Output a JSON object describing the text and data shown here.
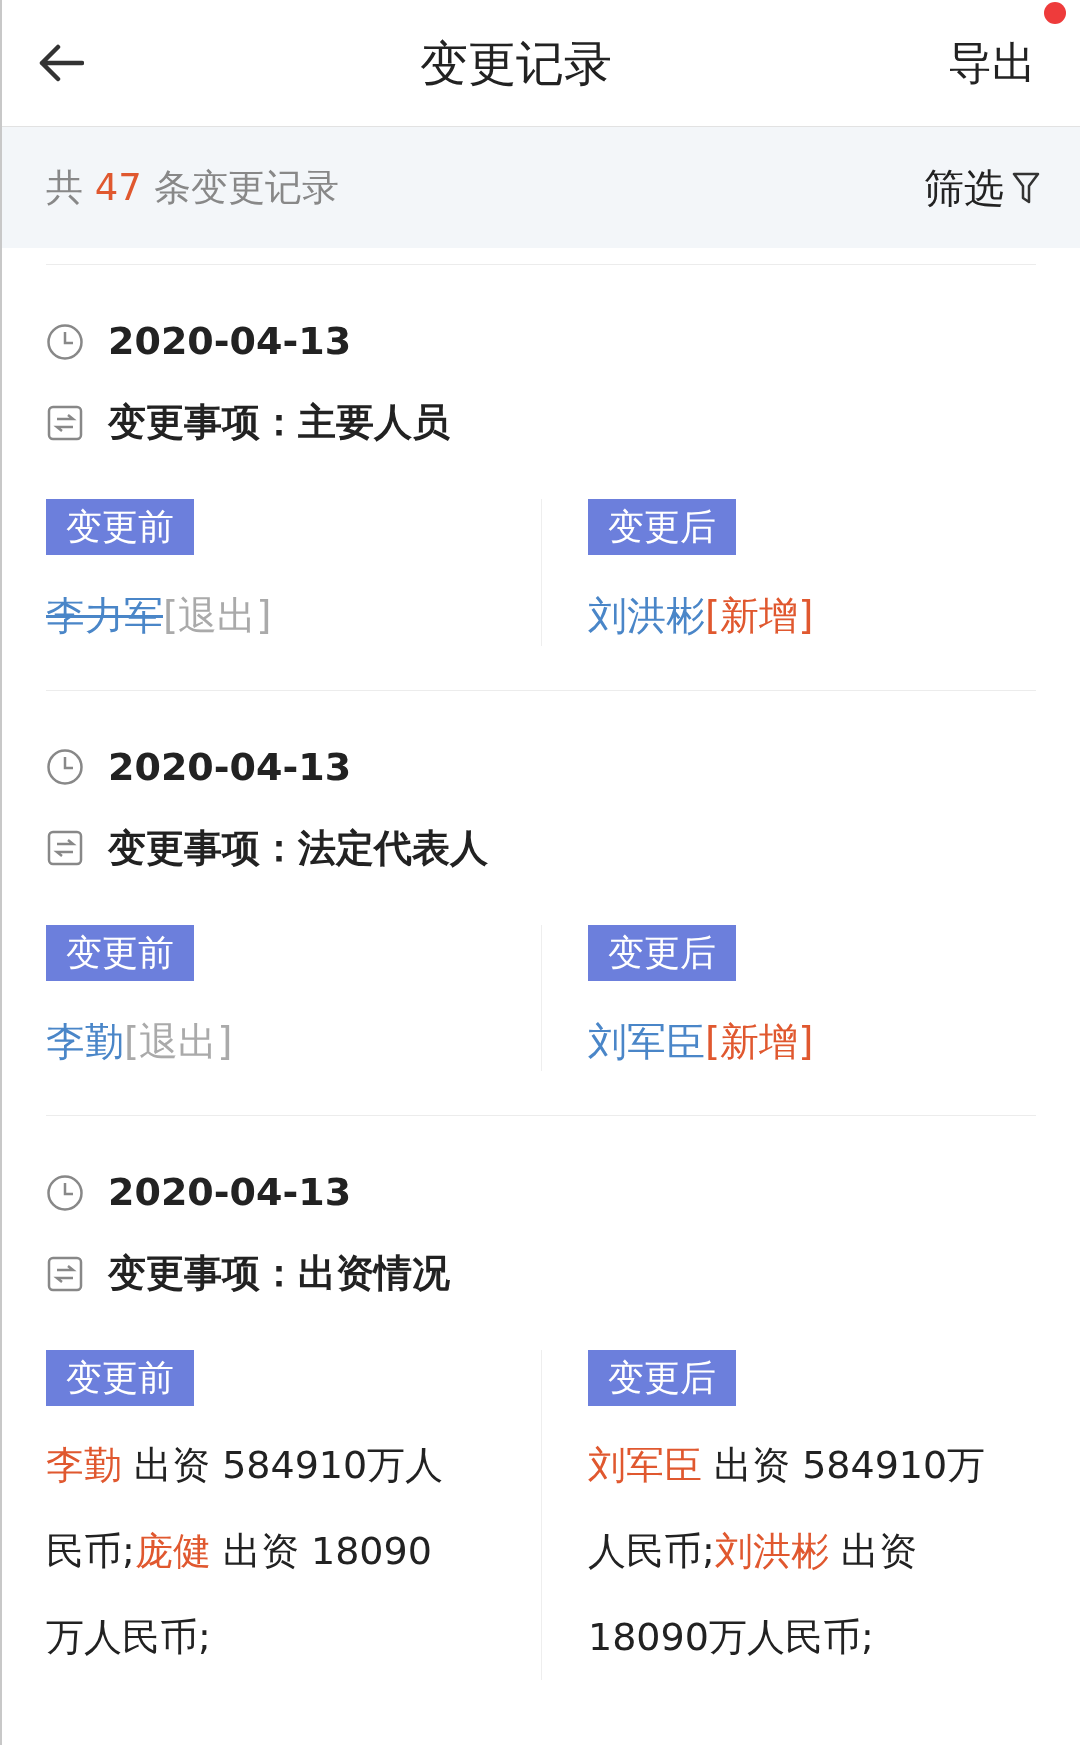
{
  "header": {
    "title": "变更记录",
    "action": {
      "label": "导出",
      "notification": true
    }
  },
  "summary": {
    "prefix": "共",
    "count": "47",
    "suffix": "条变更记录",
    "filter": "筛选"
  },
  "records": [
    {
      "date": "2020-04-13",
      "item": "变更事项：主要人员",
      "before_label": "变更前",
      "after_label": "变更后",
      "before": {
        "kind": "person",
        "name": "李力军",
        "tag": "[退出]",
        "added": false,
        "struck": true
      },
      "after": {
        "kind": "person",
        "name": "刘洪彬",
        "tag": "[新增]",
        "added": true,
        "struck": false
      }
    },
    {
      "date": "2020-04-13",
      "item": "变更事项：法定代表人",
      "before_label": "变更前",
      "after_label": "变更后",
      "before": {
        "kind": "person",
        "name": "李勤",
        "tag": "[退出]",
        "added": false,
        "struck": false
      },
      "after": {
        "kind": "person",
        "name": "刘军臣",
        "tag": "[新增]",
        "added": true,
        "struck": false
      }
    },
    {
      "date": "2020-04-13",
      "item": "变更事项：出资情况",
      "before_label": "变更前",
      "after_label": "变更后",
      "before": {
        "kind": "text",
        "parts": [
          {
            "kind": "name",
            "text": "李勤"
          },
          {
            "kind": "plain",
            "text": " 出资 584910万人民币;"
          },
          {
            "kind": "name",
            "text": "庞健"
          },
          {
            "kind": "plain",
            "text": " 出资 18090万人民币;"
          }
        ]
      },
      "after": {
        "kind": "text",
        "parts": [
          {
            "kind": "name",
            "text": "刘军臣"
          },
          {
            "kind": "plain",
            "text": " 出资 584910万人民币;"
          },
          {
            "kind": "name",
            "text": "刘洪彬"
          },
          {
            "kind": "plain",
            "text": " 出资 18090万人民币;"
          }
        ]
      }
    }
  ]
}
